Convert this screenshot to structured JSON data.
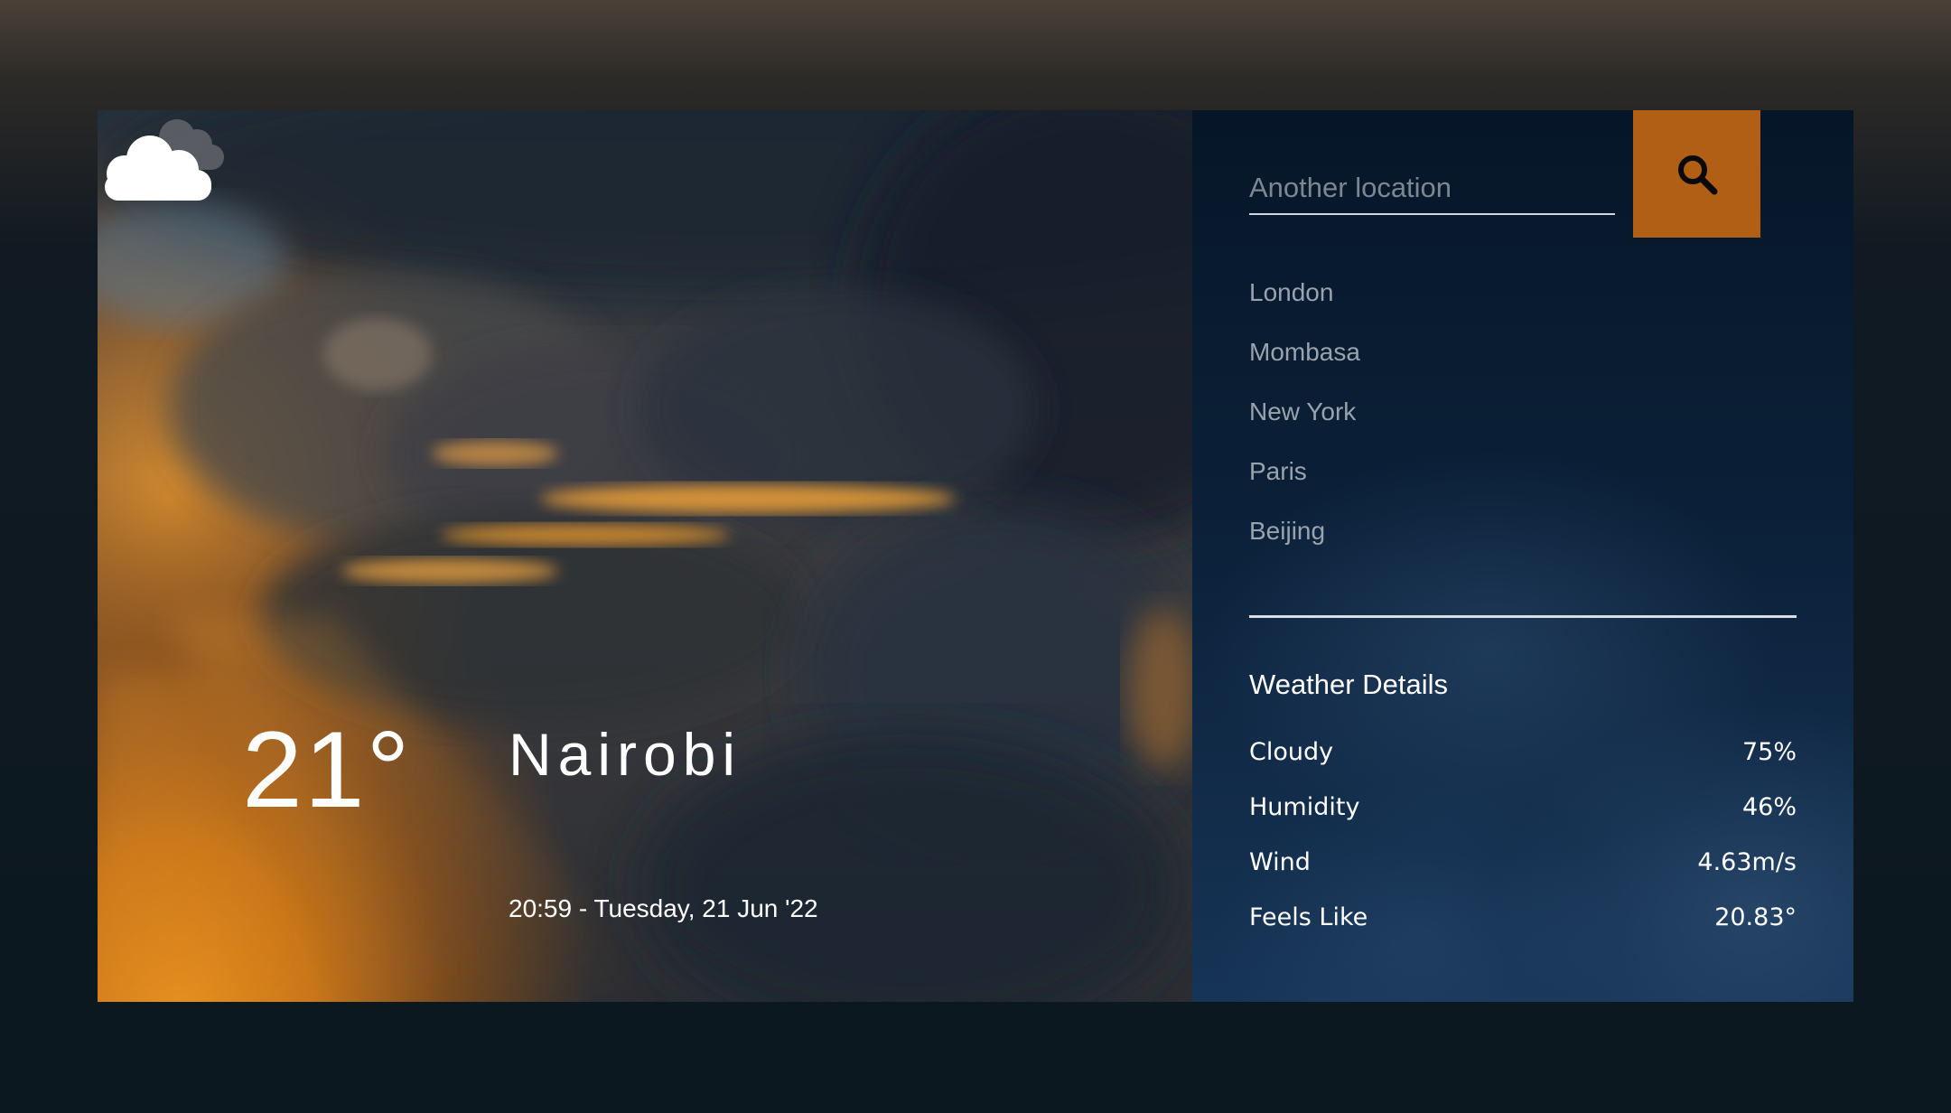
{
  "current": {
    "temperature": "21°",
    "city": "Nairobi",
    "datetime": "20:59 - Tuesday, 21 Jun '22",
    "condition_icon": "cloud-icon"
  },
  "search": {
    "placeholder": "Another location",
    "button_icon": "search-icon"
  },
  "cities": [
    "London",
    "Mombasa",
    "New York",
    "Paris",
    "Beijing"
  ],
  "details": {
    "title": "Weather Details",
    "rows": [
      {
        "label": "Cloudy",
        "value": "75%"
      },
      {
        "label": "Humidity",
        "value": "46%"
      },
      {
        "label": "Wind",
        "value": "4.63m/s"
      },
      {
        "label": "Feels Like",
        "value": "20.83°"
      }
    ]
  },
  "colors": {
    "accent": "#b05f14",
    "sidebar": "#0b2038",
    "sunset": "#e8921f"
  }
}
